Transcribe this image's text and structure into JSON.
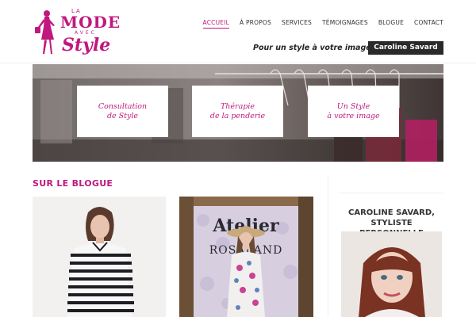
{
  "brand": {
    "logo_la": "LA",
    "logo_mode": "MODE",
    "logo_avec": "AVEC",
    "logo_style": "Style",
    "accent_color": "#c0187f"
  },
  "nav": {
    "items": [
      {
        "label": "ACCUEIL",
        "active": true
      },
      {
        "label": "À PROPOS",
        "active": false
      },
      {
        "label": "SERVICES",
        "active": false
      },
      {
        "label": "TÉMOIGNAGES",
        "active": false
      },
      {
        "label": "BLOGUE",
        "active": false
      },
      {
        "label": "CONTACT",
        "active": false
      }
    ]
  },
  "header": {
    "tagline": "Pour un style à votre image",
    "cta_label": "Caroline Savard"
  },
  "hero": {
    "cards": [
      {
        "label": "Consultation\nde Style"
      },
      {
        "label": "Thérapie\nde la penderie"
      },
      {
        "label": "Un Style\nà votre image"
      }
    ]
  },
  "blog": {
    "title": "SUR LE BLOGUE",
    "posts": [
      {
        "image": "woman-striped-sweater-photo"
      },
      {
        "image": "woman-atelier-event-photo",
        "backdrop_text_1": "Atelier",
        "backdrop_text_2": "ROSALAND"
      }
    ]
  },
  "sidebar": {
    "title": "CAROLINE SAVARD,\nSTYLISTE PERSONNELLE",
    "portrait": "caroline-savard-portrait"
  }
}
